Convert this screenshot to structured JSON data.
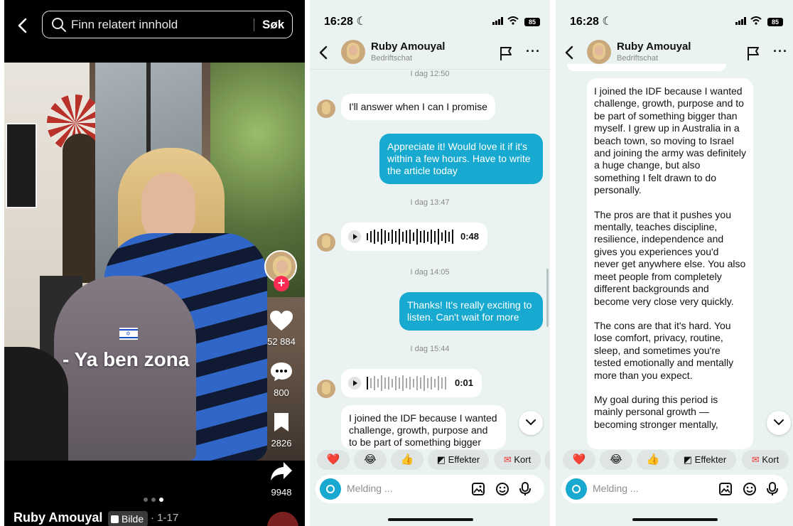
{
  "video": {
    "search": {
      "placeholder": "Finn relatert innhold",
      "button": "Søk"
    },
    "overlay_caption": "- Ya ben zona",
    "stats": {
      "likes": "52 884",
      "comments": "800",
      "saves": "2826",
      "shares": "9948"
    },
    "author": "Ruby Amouyal",
    "media_type": "Bilde",
    "page_info": "· 1-17",
    "carousel": {
      "count": 3,
      "active": 3
    }
  },
  "chat_left": {
    "status_time": "16:28",
    "battery": "85",
    "contact_name": "Ruby Amouyal",
    "contact_sub": "Bedriftschat",
    "messages": {
      "ts1": "I dag 12:50",
      "m1": "I'll answer when I can I promise",
      "m2": "Appreciate it! Would love it if it's within a few hours. Have to write the article today",
      "ts2": "I dag 13:47",
      "v1": "0:48",
      "ts3": "I dag 14:05",
      "m3": "Thanks! It's really exciting to listen. Can't wait for more",
      "ts4": "I dag 15:44",
      "v2": "0:01",
      "m4": "I joined the IDF because I wanted challenge, growth, purpose and to be part of something bigger"
    }
  },
  "chat_right": {
    "status_time": "16:28",
    "battery": "85",
    "contact_name": "Ruby Amouyal",
    "contact_sub": "Bedriftschat",
    "long_message": {
      "p1": "I joined the IDF because I wanted challenge, growth, purpose and to be part of something bigger than myself. I grew up in Australia in a beach town, so moving to Israel and joining the army was definitely a huge change, but also something I felt drawn to do personally.",
      "p2": "The pros are that it pushes you mentally, teaches discipline, resilience, independence and gives you experiences you'd never get anywhere else. You also meet people from completely different backgrounds and become very close very quickly.",
      "p3": "The cons are that it's hard. You lose comfort, privacy, routine, sleep, and sometimes you're tested emotionally and mentally more than you expect.",
      "p4": "My goal during this period is mainly personal growth — becoming stronger mentally,"
    }
  },
  "quick_reactions": {
    "effects": "Effekter",
    "cards": "Kort"
  },
  "composer": {
    "placeholder": "Melding ..."
  },
  "colors": {
    "accent": "#17a9cf",
    "chat_bg": "#eaf2f2",
    "like_red": "#fe2c55"
  }
}
